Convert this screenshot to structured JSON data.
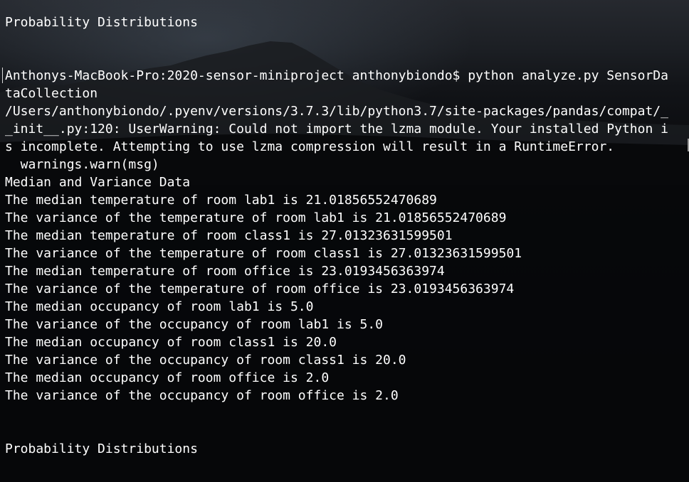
{
  "terminal": {
    "background": "#08090b",
    "text_color": "#ffffff",
    "lines": [
      "Probability Distributions",
      "",
      "",
      "Anthonys-MacBook-Pro:2020-sensor-miniproject anthonybiondo$ python analyze.py SensorDa",
      "taCollection",
      "/Users/anthonybiondo/.pyenv/versions/3.7.3/lib/python3.7/site-packages/pandas/compat/_",
      "_init__.py:120: UserWarning: Could not import the lzma module. Your installed Python i",
      "s incomplete. Attempting to use lzma compression will result in a RuntimeError.",
      "  warnings.warn(msg)",
      "Median and Variance Data",
      "The median temperature of room lab1 is 21.01856552470689",
      "The variance of the temperature of room lab1 is 21.01856552470689",
      "The median temperature of room class1 is 27.01323631599501",
      "The variance of the temperature of room class1 is 27.01323631599501",
      "The median temperature of room office is 23.0193456363974",
      "The variance of the temperature of room office is 23.0193456363974",
      "The median occupancy of room lab1 is 5.0",
      "The variance of the occupancy of room lab1 is 5.0",
      "The median occupancy of room class1 is 20.0",
      "The variance of the occupancy of room class1 is 20.0",
      "The median occupancy of room office is 2.0",
      "The variance of the occupancy of room office is 2.0",
      "",
      "",
      "Probability Distributions"
    ]
  }
}
